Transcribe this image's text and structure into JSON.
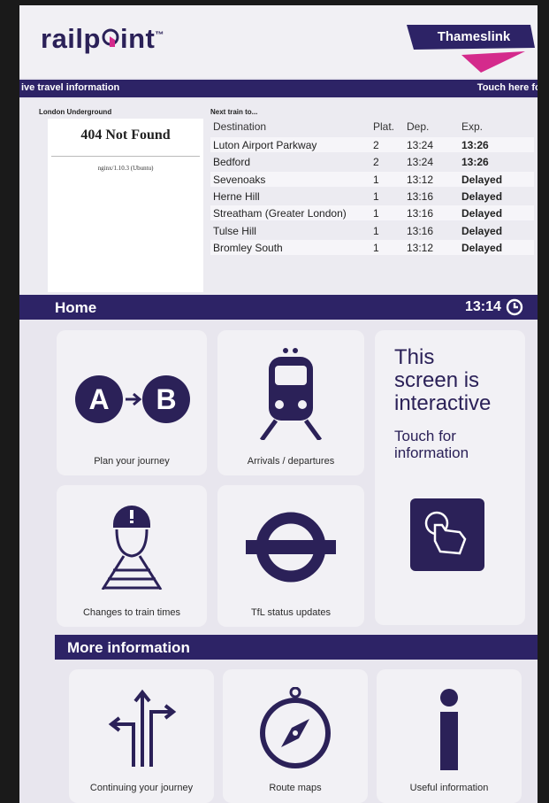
{
  "header": {
    "logo_text_before": "railp",
    "logo_text_after": "int",
    "logo_mark": "™",
    "operator": "Thameslink"
  },
  "ticker": {
    "left_text": "ive travel information",
    "right_text": "Touch here for"
  },
  "underground": {
    "heading": "London Underground",
    "error_title": "404 Not Found",
    "error_server": "nginx/1.10.3 (Ubuntu)"
  },
  "departures": {
    "heading": "Next train to...",
    "columns": {
      "destination": "Destination",
      "platform": "Plat.",
      "departure": "Dep.",
      "expected": "Exp."
    },
    "rows": [
      {
        "destination": "Luton Airport Parkway",
        "platform": "2",
        "departure": "13:24",
        "expected": "13:26"
      },
      {
        "destination": "Bedford",
        "platform": "2",
        "departure": "13:24",
        "expected": "13:26"
      },
      {
        "destination": "Sevenoaks",
        "platform": "1",
        "departure": "13:12",
        "expected": "Delayed"
      },
      {
        "destination": "Herne Hill",
        "platform": "1",
        "departure": "13:16",
        "expected": "Delayed"
      },
      {
        "destination": "Streatham (Greater London)",
        "platform": "1",
        "departure": "13:16",
        "expected": "Delayed"
      },
      {
        "destination": "Tulse Hill",
        "platform": "1",
        "departure": "13:16",
        "expected": "Delayed"
      },
      {
        "destination": "Bromley South",
        "platform": "1",
        "departure": "13:12",
        "expected": "Delayed"
      }
    ]
  },
  "home_bar": {
    "label": "Home",
    "time": "13:14",
    "clock_icon": "clock-icon"
  },
  "tiles": {
    "plan": {
      "label": "Plan your journey",
      "icon": "a-to-b-icon",
      "icon_a": "A",
      "icon_b": "B"
    },
    "arrivals": {
      "label": "Arrivals / departures",
      "icon": "train-icon"
    },
    "interactive": {
      "title_lines": [
        "This",
        "screen is",
        "interactive"
      ],
      "sub_lines": [
        "Touch for",
        "information"
      ],
      "icon": "touch-hand-icon"
    },
    "changes": {
      "label": "Changes to train times",
      "icon": "worker-on-track-icon"
    },
    "tfl": {
      "label": "TfL status updates",
      "icon": "tfl-roundel-icon"
    }
  },
  "more_bar": {
    "label": "More information"
  },
  "more_tiles": {
    "continuing": {
      "label": "Continuing your journey",
      "icon": "directions-arrows-icon"
    },
    "routes": {
      "label": "Route maps",
      "icon": "compass-icon"
    },
    "useful": {
      "label": "Useful information",
      "icon": "info-icon"
    }
  },
  "colors": {
    "brand_purple": "#2d2366",
    "thameslink_pink": "#d42a8c",
    "panel": "#f2f1f5"
  }
}
